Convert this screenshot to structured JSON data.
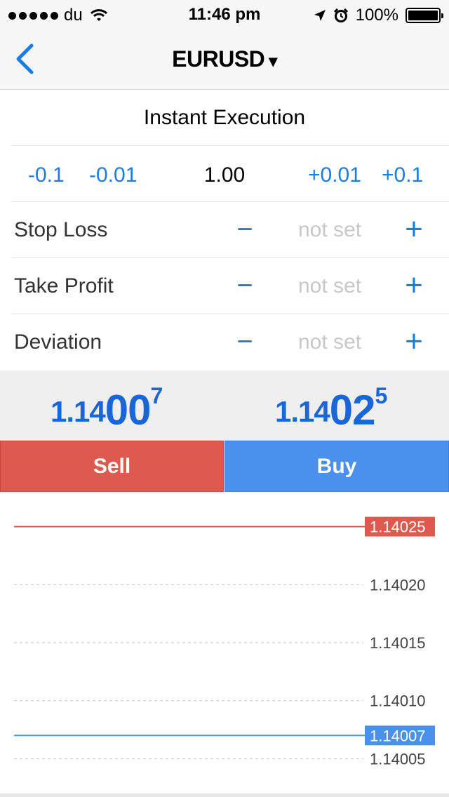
{
  "status_bar": {
    "carrier": "du",
    "time": "11:46 pm",
    "battery": "100%",
    "battery_level": 1.0
  },
  "nav": {
    "title": "EURUSD",
    "caret": "▾",
    "back_icon": "chevron-left-icon"
  },
  "execution": {
    "mode": "Instant Execution"
  },
  "volume": {
    "dec_large": "-0.1",
    "dec_small": "-0.01",
    "value": "1.00",
    "inc_small": "+0.01",
    "inc_large": "+0.1"
  },
  "params": [
    {
      "label": "Stop Loss",
      "minus": "−",
      "value": "not set",
      "plus": "+"
    },
    {
      "label": "Take Profit",
      "minus": "−",
      "value": "not set",
      "plus": "+"
    },
    {
      "label": "Deviation",
      "minus": "−",
      "value": "not set",
      "plus": "+"
    }
  ],
  "quotes": {
    "bid": {
      "prefix": "1.14",
      "big": "00",
      "sup": "7"
    },
    "ask": {
      "prefix": "1.14",
      "big": "02",
      "sup": "5"
    }
  },
  "buttons": {
    "sell": "Sell",
    "buy": "Buy"
  },
  "colors": {
    "accent": "#1a7ce6",
    "sell": "#de5a4e",
    "buy": "#4a90ec"
  },
  "chart_data": {
    "type": "line",
    "ylim": [
      1.14002,
      1.14028
    ],
    "levels": [
      1.1402,
      1.14015,
      1.1401,
      1.14005
    ],
    "level_labels": [
      "1.14020",
      "1.14015",
      "1.14010",
      "1.14005"
    ],
    "ask_line": {
      "value": 1.14025,
      "label": "1.14025",
      "color": "#de5a4e"
    },
    "bid_line": {
      "value": 1.14007,
      "label": "1.14007",
      "color": "#4a90ec"
    }
  }
}
